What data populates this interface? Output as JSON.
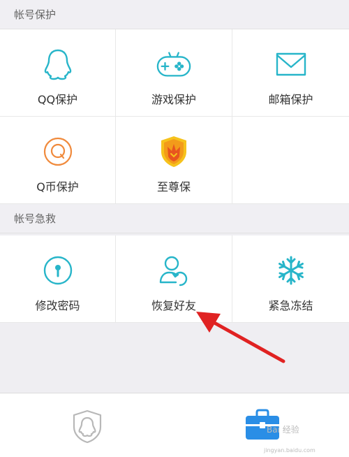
{
  "sections": [
    {
      "title": "帐号保护",
      "items": [
        {
          "label": "QQ保护",
          "icon": "penguin-icon"
        },
        {
          "label": "游戏保护",
          "icon": "gamepad-icon"
        },
        {
          "label": "邮箱保护",
          "icon": "mail-icon"
        },
        {
          "label": "Q币保护",
          "icon": "q-coin-icon"
        },
        {
          "label": "至尊保",
          "icon": "premium-shield-icon"
        }
      ]
    },
    {
      "title": "帐号急救",
      "items": [
        {
          "label": "修改密码",
          "icon": "keyhole-icon"
        },
        {
          "label": "恢复好友",
          "icon": "restore-friend-icon"
        },
        {
          "label": "紧急冻结",
          "icon": "snowflake-icon"
        }
      ]
    }
  ],
  "bottom_nav": [
    {
      "icon": "penguin-shield-icon",
      "state": "inactive"
    },
    {
      "icon": "toolbox-icon",
      "state": "active"
    }
  ],
  "watermark": {
    "text": "Bai 经验",
    "url": "jingyan.baidu.com"
  },
  "colors": {
    "accent": "#27b5c9",
    "coin": "#f08a3c",
    "active_tab": "#2a8ee6",
    "arrow": "#e02222"
  }
}
